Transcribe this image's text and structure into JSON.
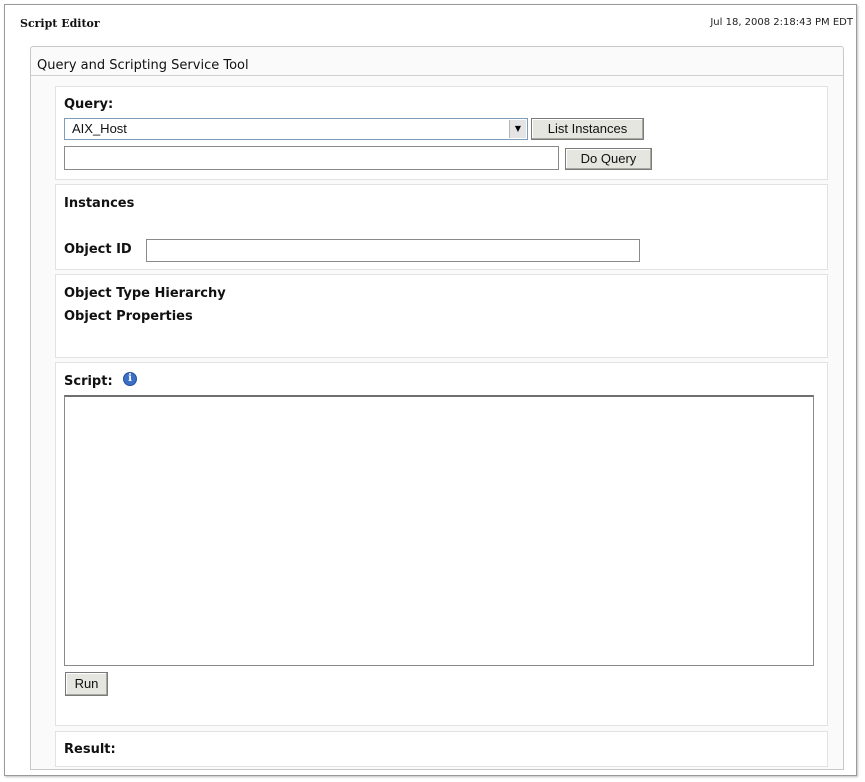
{
  "header": {
    "app_title": "Script Editor",
    "timestamp": "Jul 18, 2008 2:18:43 PM EDT"
  },
  "panel": {
    "title": "Query and Scripting Service Tool"
  },
  "query": {
    "label": "Query:",
    "selected_value": "AIX_Host",
    "list_instances_label": "List Instances",
    "do_query_label": "Do Query",
    "query_text": ""
  },
  "instances": {
    "label": "Instances",
    "object_id_label": "Object ID",
    "object_id_value": ""
  },
  "object_info": {
    "type_hierarchy_label": "Object Type Hierarchy",
    "properties_label": "Object Properties"
  },
  "script": {
    "label": "Script:",
    "info_icon_glyph": "i",
    "content": "",
    "run_label": "Run"
  },
  "result": {
    "label": "Result:"
  }
}
